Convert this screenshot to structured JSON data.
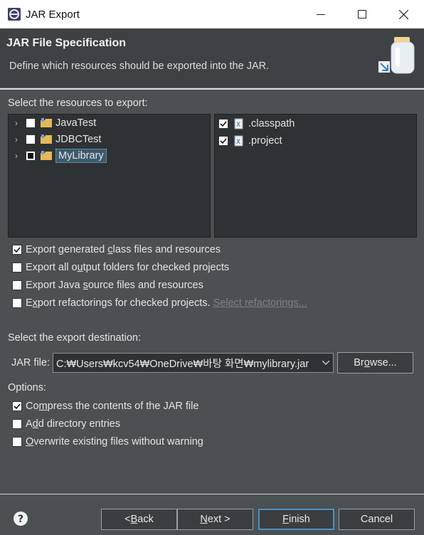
{
  "window": {
    "title": "JAR Export"
  },
  "banner": {
    "title": "JAR File Specification",
    "description": "Define which resources should be exported into the JAR."
  },
  "resources": {
    "label": "Select the resources to export:",
    "projects": [
      {
        "label": "JavaTest",
        "state": "unchecked"
      },
      {
        "label": "JDBCTest",
        "state": "unchecked"
      },
      {
        "label": "MyLibrary",
        "state": "partial",
        "selected": true
      }
    ],
    "files": [
      {
        "label": ".classpath",
        "checked": true
      },
      {
        "label": ".project",
        "checked": true
      }
    ]
  },
  "options_top": {
    "export_class_files": {
      "pre": "Export generated ",
      "mn": "c",
      "post": "lass files and resources",
      "checked": true
    },
    "export_output_folders": {
      "pre": "Export all o",
      "mn": "u",
      "post": "tput folders for checked projects",
      "checked": false
    },
    "export_source": {
      "pre": "Export Java ",
      "mn": "s",
      "post": "ource files and resources",
      "checked": false
    },
    "export_refactorings": {
      "pre": "E",
      "mn": "x",
      "post": "port refactorings for checked projects.",
      "checked": false
    },
    "select_refactorings_link": "Select refactorings..."
  },
  "destination": {
    "label": "Select the export destination:",
    "jar_file_label": "JAR file:",
    "jar_file_value": "C:₩Users₩kcv54₩OneDrive₩바탕 화면₩mylibrary.jar",
    "browse": {
      "pre": "Br",
      "mn": "o",
      "post": "wse..."
    }
  },
  "options": {
    "label": "Options:",
    "compress": {
      "pre": "Co",
      "mn": "m",
      "post": "press the contents of the JAR file",
      "checked": true
    },
    "add_dirs": {
      "pre": "A",
      "mn": "d",
      "post": "d directory entries",
      "checked": false
    },
    "overwrite": {
      "pre": "",
      "mn": "O",
      "post": "verwrite existing files without warning",
      "checked": false
    }
  },
  "buttons": {
    "back": {
      "pre": "< ",
      "mn": "B",
      "post": "ack"
    },
    "next": {
      "pre": "",
      "mn": "N",
      "post": "ext >"
    },
    "finish": {
      "pre": "",
      "mn": "F",
      "post": "inish"
    },
    "cancel": "Cancel"
  },
  "colors": {
    "background": "#4b5052",
    "panel": "#2f3234",
    "banner": "#3e4244",
    "accent_border": "#4f8fc8"
  }
}
